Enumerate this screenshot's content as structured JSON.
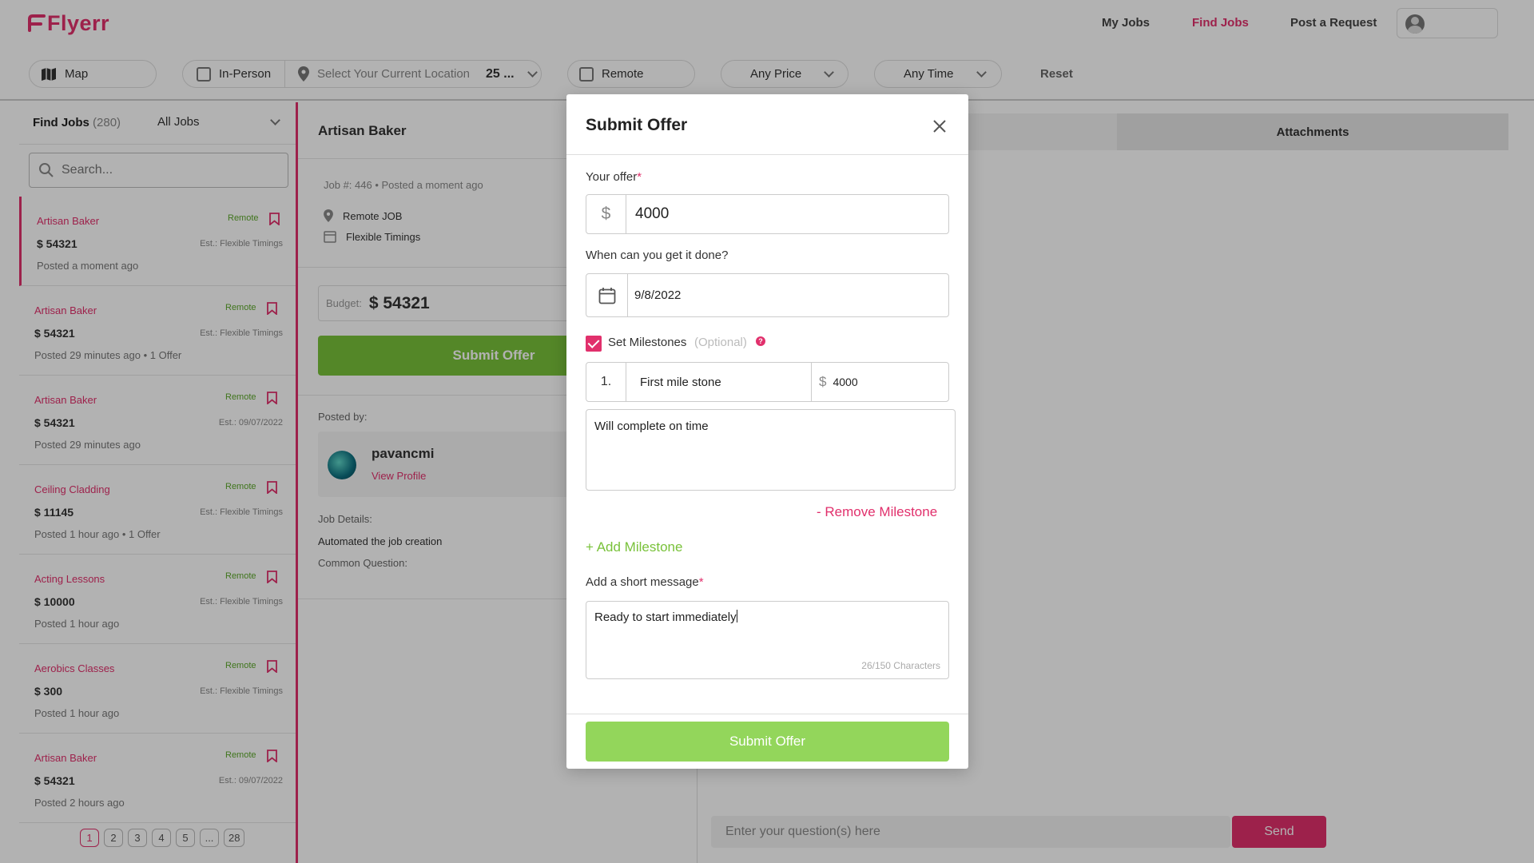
{
  "brand": {
    "name": "Flyerr",
    "accent": "#e1306c",
    "green": "#79c23a"
  },
  "nav": {
    "links": [
      {
        "label": "My Jobs",
        "active": false
      },
      {
        "label": "Find Jobs",
        "active": true
      },
      {
        "label": "Post a Request",
        "active": false
      }
    ]
  },
  "filters": {
    "map_label": "Map",
    "in_person_label": "In-Person",
    "location_placeholder": "Select Your Current Location",
    "distance_value": "25 ...",
    "remote_label": "Remote",
    "price_label": "Any Price",
    "time_label": "Any Time",
    "reset_label": "Reset"
  },
  "joblist": {
    "title": "Find Jobs",
    "count": "(280)",
    "filter_value": "All Jobs",
    "search_placeholder": "Search...",
    "items": [
      {
        "title": "Artisan Baker",
        "tag": "Remote",
        "price": "$ 54321",
        "est": "Est.: Flexible Timings",
        "posted": "Posted a moment ago"
      },
      {
        "title": "Artisan Baker",
        "tag": "Remote",
        "price": "$ 54321",
        "est": "Est.: Flexible Timings",
        "posted": "Posted 29 minutes ago  • 1 Offer"
      },
      {
        "title": "Artisan Baker",
        "tag": "Remote",
        "price": "$ 54321",
        "est": "Est.: 09/07/2022",
        "posted": "Posted 29 minutes ago"
      },
      {
        "title": "Ceiling Cladding",
        "tag": "Remote",
        "price": "$ 11145",
        "est": "Est.: Flexible Timings",
        "posted": "Posted 1 hour ago  • 1 Offer"
      },
      {
        "title": "Acting Lessons",
        "tag": "Remote",
        "price": "$ 10000",
        "est": "Est.: Flexible Timings",
        "posted": "Posted 1 hour ago"
      },
      {
        "title": "Aerobics Classes",
        "tag": "Remote",
        "price": "$ 300",
        "est": "Est.: Flexible Timings",
        "posted": "Posted 1 hour ago"
      },
      {
        "title": "Artisan Baker",
        "tag": "Remote",
        "price": "$ 54321",
        "est": "Est.: 09/07/2022",
        "posted": "Posted 2 hours ago"
      }
    ],
    "pages": [
      "1",
      "2",
      "3",
      "4",
      "5",
      "...",
      "28"
    ],
    "current_page": "1"
  },
  "detail": {
    "title": "Artisan Baker",
    "meta": "Job #: 446 • Posted a moment ago",
    "location": "Remote JOB",
    "timing": "Flexible Timings",
    "budget_label": "Budget:",
    "budget_value": "$ 54321",
    "submit_label": "Submit Offer",
    "posted_by_label": "Posted by:",
    "poster_name": "pavancmi",
    "poster_link": "View Profile",
    "job_details_label": "Job Details:",
    "job_details_value": "Automated the job creation",
    "common_question_label": "Common Question:"
  },
  "rightpanel": {
    "tab_attachments": "Attachments",
    "question_placeholder": "Enter your question(s) here",
    "send_label": "Send"
  },
  "modal": {
    "title": "Submit Offer",
    "offer_label": "Your offer",
    "required_mark": "*",
    "currency": "$",
    "offer_value": "4000",
    "date_label": "When can you get it done?",
    "date_value": "9/8/2022",
    "milestones_label": "Set Milestones",
    "milestones_optional": "(Optional)",
    "help_glyph": "?",
    "milestone": {
      "index": "1.",
      "name": "First mile stone",
      "amount": "4000",
      "description": "Will complete on time"
    },
    "remove_milestone": "- Remove Milestone",
    "add_milestone": "+ Add Milestone",
    "message_label": "Add a short message",
    "message_value": "Ready to start immediately",
    "char_count": "26/150 Characters",
    "submit_label": "Submit Offer"
  }
}
